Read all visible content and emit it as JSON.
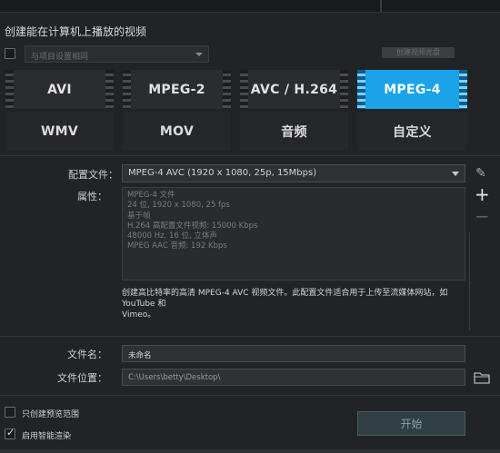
{
  "header": {
    "title": "创建能在计算机上播放的视频"
  },
  "device_select": {
    "checkbox_checked": false,
    "placeholder": "与项目设置相同",
    "hint": "创建视频光盘"
  },
  "formats": {
    "row1": [
      "AVI",
      "MPEG-2",
      "AVC / H.264",
      "MPEG-4"
    ],
    "row2": [
      "WMV",
      "MOV",
      "音频",
      "自定义"
    ],
    "selected": "MPEG-4"
  },
  "profile": {
    "label": "配置文件：",
    "value": "MPEG-4 AVC (1920 x 1080, 25p, 15Mbps)"
  },
  "properties": {
    "label": "属性：",
    "lines": [
      "MPEG-4 文件",
      "24 位, 1920 x 1080, 25 fps",
      "基于帧",
      "H.264 高配置文件视频: 15000 Kbps",
      "48000 Hz, 16 位, 立体声",
      "MPEG AAC 音频: 192 Kbps"
    ]
  },
  "description": {
    "line1": "创建高比特率的高清 MPEG-4 AVC 视频文件。此配置文件适合用于上传至流媒体网站，如 YouTube 和",
    "line2": "Vimeo。"
  },
  "side_actions": {
    "edit": "✎",
    "add": "+",
    "remove": "−"
  },
  "filename": {
    "label": "文件名：",
    "value": "未命名"
  },
  "location": {
    "label": "文件位置：",
    "value": "C:\\Users\\betty\\Desktop\\"
  },
  "options": {
    "preview_range_label": "只创建预览范围",
    "preview_range_checked": false,
    "smart_render_label": "启用智能渲染",
    "smart_render_checked": true
  },
  "start_button": "开始",
  "colors": {
    "background": "#222326",
    "selected_tile": "#1aa3e8",
    "tile": "#2d2e33"
  }
}
